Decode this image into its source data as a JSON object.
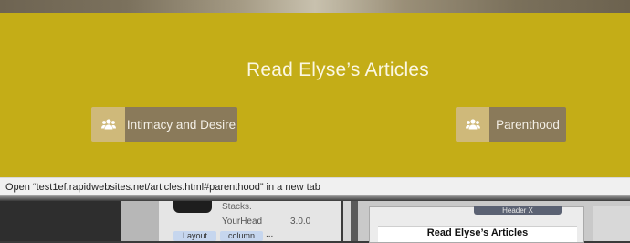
{
  "banner": {
    "title": "Read Elyse’s Articles",
    "background_color": "#c4ad17",
    "buttons": [
      {
        "label": "Intimacy and Desire",
        "icon": "users-icon"
      },
      {
        "label": "Parenthood",
        "icon": "users-icon"
      }
    ]
  },
  "status_bar": {
    "text": "Open “test1ef.rapidwebsites.net/articles.html#parenthood” in a new tab"
  },
  "background_app": {
    "blocks_word": "Stacks.",
    "stack_author": "YourHead",
    "stack_version": "3.0.0",
    "tags": [
      "Layout",
      "column"
    ],
    "tags_more": "...",
    "preview": {
      "header_chip": "Header X",
      "title": "Read Elyse’s Articles"
    }
  }
}
